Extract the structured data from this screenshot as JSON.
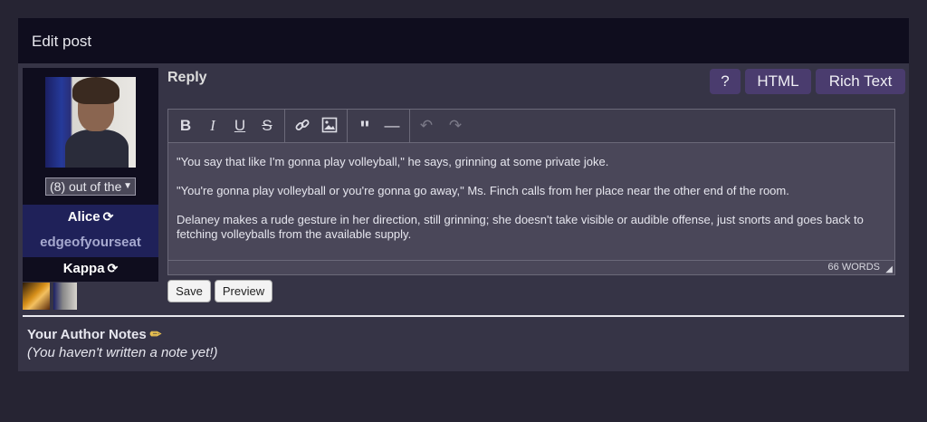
{
  "header": {
    "title": "Edit post"
  },
  "character": {
    "selector_value": "(8) out of the",
    "name": "Alice",
    "username": "edgeofyourseat",
    "account": "Kappa"
  },
  "reply": {
    "label": "Reply",
    "modes": [
      "?",
      "HTML",
      "Rich Text"
    ],
    "toolbar": [
      "bold-icon",
      "italic-icon",
      "underline-icon",
      "strikethrough-icon",
      "link-icon",
      "image-icon",
      "blockquote-icon",
      "horizontal-rule-icon",
      "undo-icon",
      "redo-icon"
    ],
    "paragraphs": [
      "\"You say that like I'm gonna play volleyball,\" he says, grinning at some private joke.",
      "\"You're gonna play volleyball or you're gonna go away,\" Ms. Finch calls from her place near the other end of the room.",
      "Delaney makes a rude gesture in her direction, still grinning; she doesn't take visible or audible offense, just snorts and goes back to fetching volleyballs from the available supply."
    ],
    "word_count": "66 WORDS",
    "save_label": "Save",
    "preview_label": "Preview"
  },
  "notes": {
    "title": "Your Author Notes",
    "empty_text": "(You haven't written a note yet!)"
  },
  "colors": {
    "background": "#262433",
    "header": "#0f0d1e",
    "panel": "#363446",
    "accent": "#4a3c6e",
    "character_bar": "#1f2159"
  }
}
